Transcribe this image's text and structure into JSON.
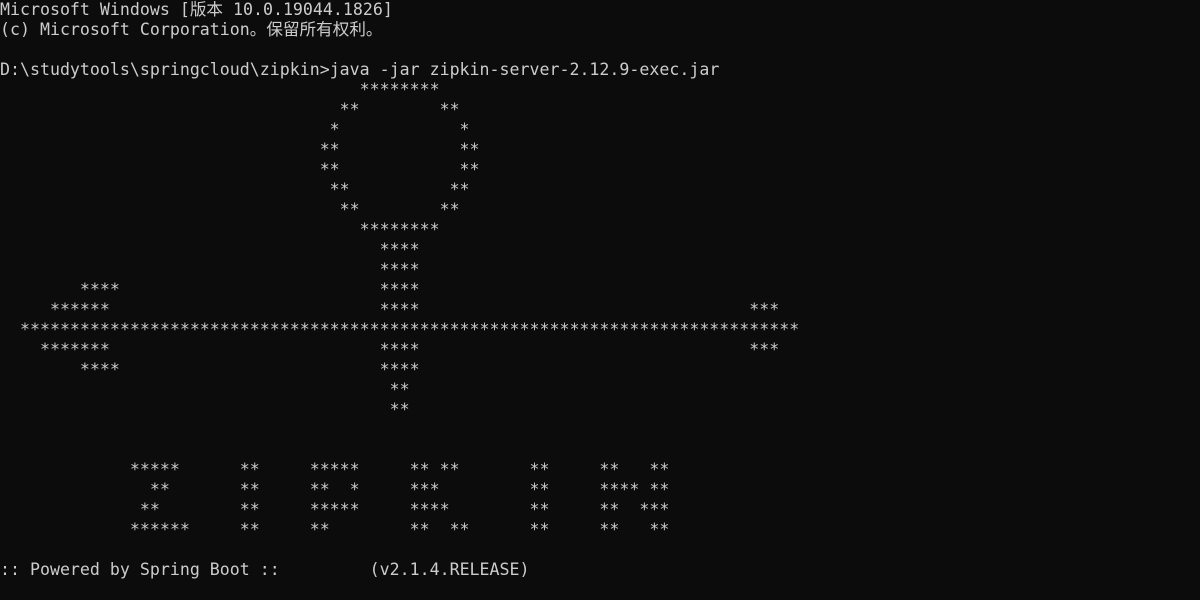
{
  "console": {
    "header": [
      "Microsoft Windows [版本 10.0.19044.1826]",
      "(c) Microsoft Corporation。保留所有权利。"
    ],
    "prompt": {
      "path": "D:\\studytools\\springcloud\\zipkin>",
      "command": "java -jar zipkin-server-2.12.9-exec.jar"
    },
    "banner": [
      "                                    ********",
      "                                  **        **",
      "                                 *            *",
      "                                **            **",
      "                                **            **",
      "                                 **          **",
      "                                  **        **",
      "                                    ********",
      "                                      ****",
      "                                      ****",
      "        ****                          ****",
      "     ******                           ****                                 ***",
      "  ******************************************************************************",
      "    *******                           ****                                 ***",
      "        ****                          ****",
      "                                       **",
      "                                       **",
      "",
      "",
      "             *****      **     *****     ** **       **     **   **",
      "               **       **     **  *     ***         **     **** **",
      "              **        **     *****     ****        **     **  ***",
      "             ******     **     **        **  **      **     **   **"
    ],
    "footer": {
      "powered": ":: Powered by Spring Boot ::",
      "gap": "         ",
      "version": "(v2.1.4.RELEASE)"
    },
    "colors": {
      "background": "#0c0c0c",
      "text": "#cccccc"
    }
  }
}
